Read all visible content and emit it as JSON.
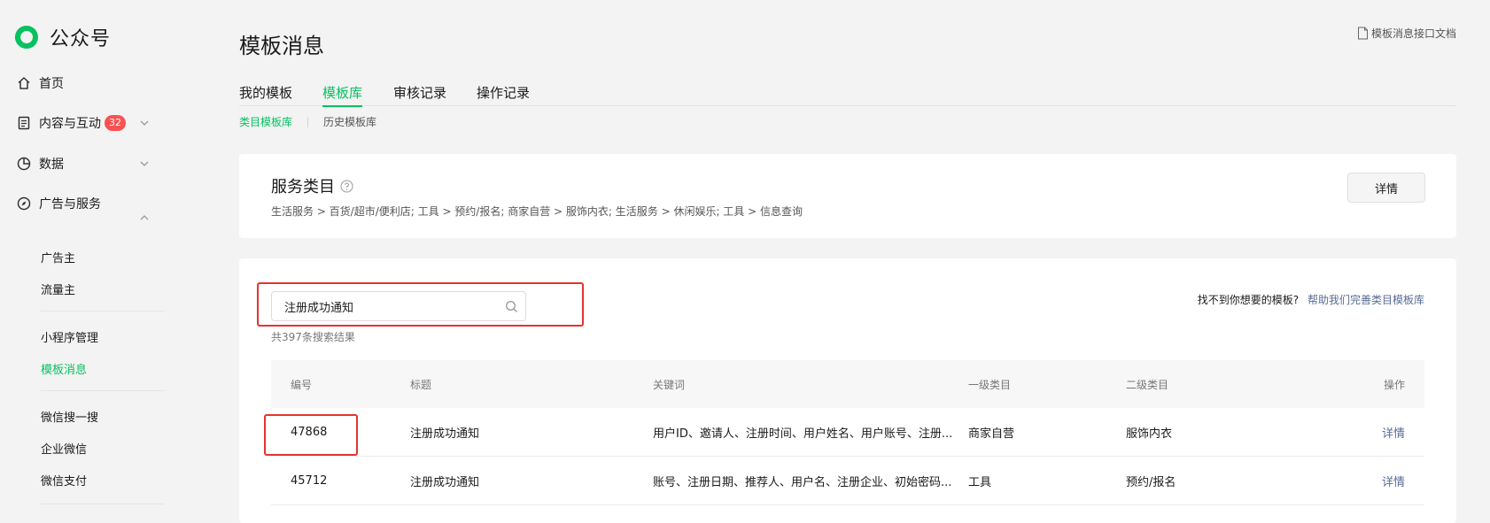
{
  "app": {
    "name": "公众号"
  },
  "sidebar": {
    "nav": [
      {
        "label": "首页"
      },
      {
        "label": "内容与互动",
        "badge": "32"
      },
      {
        "label": "数据"
      },
      {
        "label": "广告与服务"
      }
    ],
    "ads_sub": [
      "广告主",
      "流量主"
    ],
    "group2": [
      "小程序管理",
      "模板消息"
    ],
    "group3": [
      "微信搜一搜",
      "企业微信",
      "微信支付"
    ],
    "colors": {
      "accent": "#07c160",
      "badge": "#fa5151"
    }
  },
  "header": {
    "title": "模板消息",
    "doc_link": "模板消息接口文档"
  },
  "tabs": [
    "我的模板",
    "模板库",
    "审核记录",
    "操作记录"
  ],
  "subtabs": [
    "类目模板库",
    "历史模板库"
  ],
  "service": {
    "title": "服务类目",
    "breadcrumb": "生活服务 > 百货/超市/便利店; 工具 > 预约/报名; 商家自营 > 服饰内衣; 生活服务 > 休闲娱乐; 工具 > 信息查询",
    "detail_button": "详情"
  },
  "search": {
    "value": "注册成功通知",
    "result_count": "共397条搜索结果",
    "missing_text": "找不到你想要的模板?",
    "help_link": "帮助我们完善类目模板库"
  },
  "table": {
    "columns": [
      "编号",
      "标题",
      "关键词",
      "一级类目",
      "二级类目",
      "操作"
    ],
    "rows": [
      {
        "id": "47868",
        "title": "注册成功通知",
        "keywords": "用户ID、邀请人、注册时间、用户姓名、用户账号、注册...",
        "cat1": "商家自营",
        "cat2": "服饰内衣",
        "op": "详情"
      },
      {
        "id": "45712",
        "title": "注册成功通知",
        "keywords": "账号、注册日期、推荐人、用户名、注册企业、初始密码...",
        "cat1": "工具",
        "cat2": "预约/报名",
        "op": "详情"
      }
    ]
  },
  "annotation_color": "#e3342f"
}
